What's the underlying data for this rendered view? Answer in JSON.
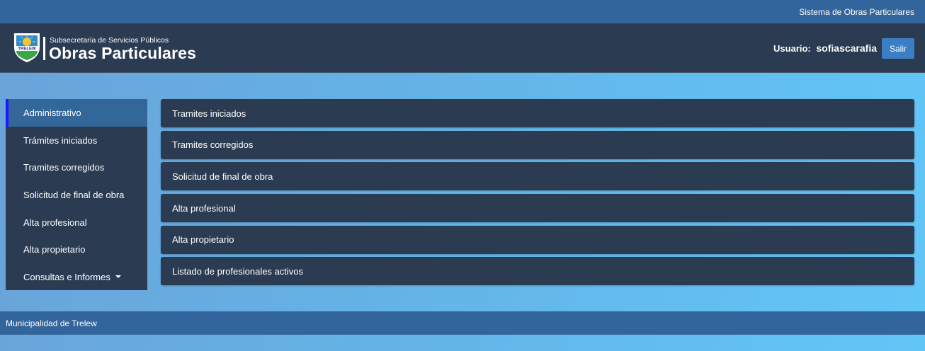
{
  "topbar": {
    "system_name": "Sistema de Obras Particulares"
  },
  "header": {
    "logo_badge_text": "TRELEW",
    "subtitle": "Subsecretaría de Servicios Públicos",
    "title": "Obras Particulares",
    "user_label": "Usuario:",
    "username": "sofiascarafia",
    "logout_label": "Salir"
  },
  "sidebar": {
    "items": [
      {
        "label": "Administrativo",
        "active": true
      },
      {
        "label": "Trámites iniciados"
      },
      {
        "label": "Tramites corregidos"
      },
      {
        "label": "Solicitud de final de obra"
      },
      {
        "label": "Alta profesional"
      },
      {
        "label": "Alta propietario"
      },
      {
        "label": "Consultas e Informes",
        "icon": "caret-down-icon"
      }
    ]
  },
  "main": {
    "items": [
      {
        "label": "Tramites iniciados"
      },
      {
        "label": "Tramites corregidos"
      },
      {
        "label": "Solicitud de final de obra"
      },
      {
        "label": "Alta profesional"
      },
      {
        "label": "Alta propietario"
      },
      {
        "label": "Listado de profesionales activos"
      }
    ]
  },
  "footer": {
    "text": "Municipalidad de Trelew"
  },
  "colors": {
    "topbar": "#31659b",
    "header": "#2b3b52",
    "panel": "#2b3b52",
    "active_item": "#336699",
    "active_marker": "#1a1aff",
    "button": "#3a7fc4"
  }
}
